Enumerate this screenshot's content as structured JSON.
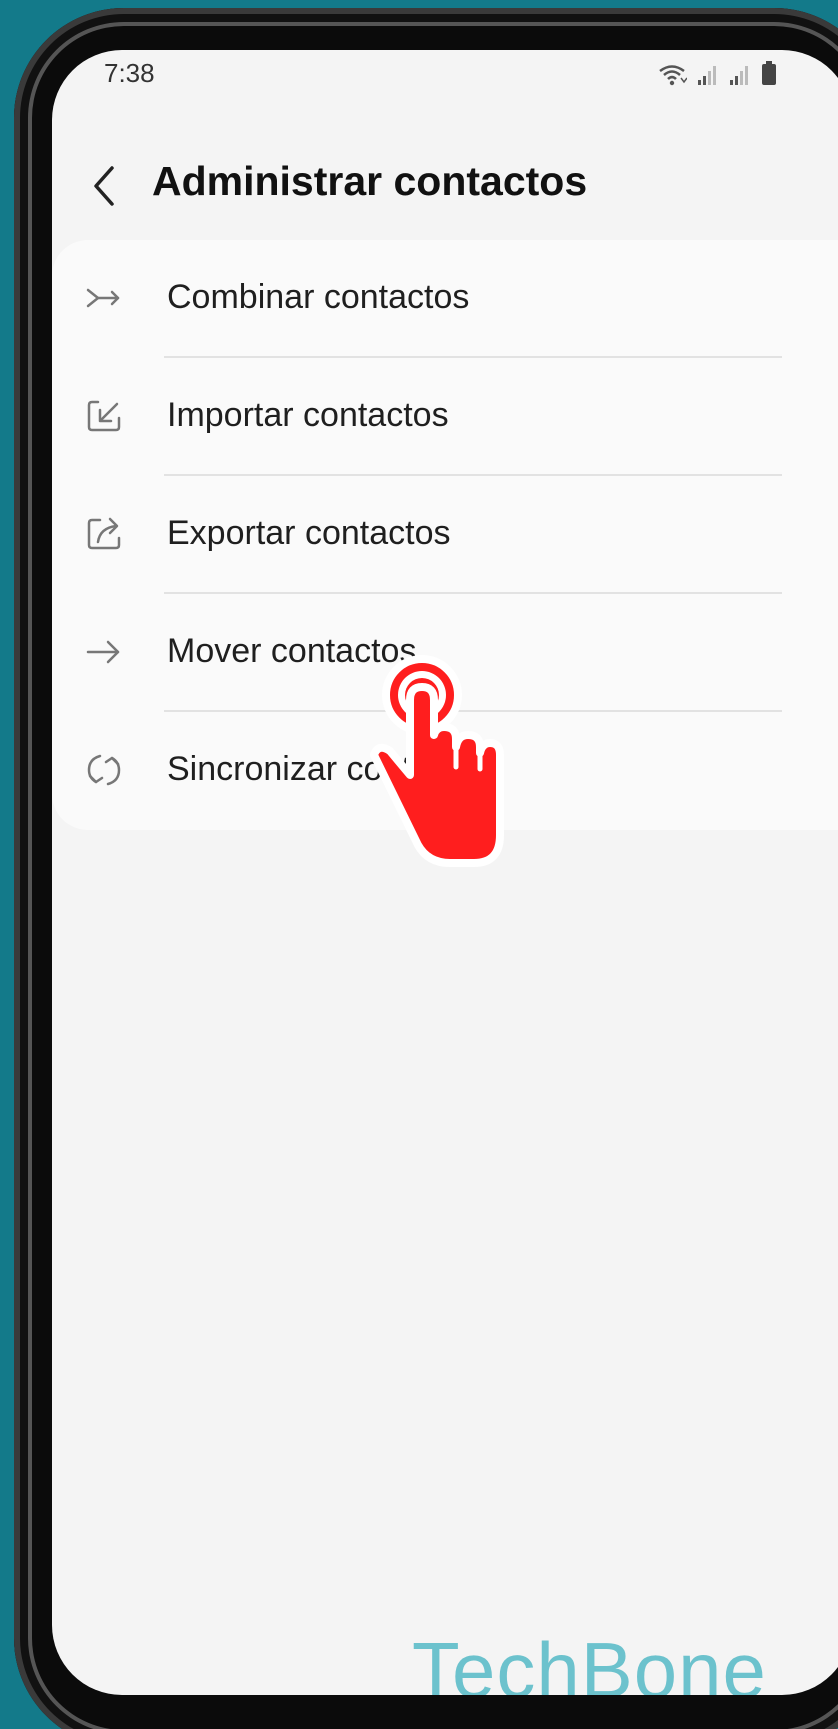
{
  "status_bar": {
    "time": "7:38",
    "icons": [
      "wifi-icon",
      "signal-icon",
      "signal-icon",
      "battery-icon"
    ]
  },
  "header": {
    "back_icon": "chevron-left-icon",
    "title": "Administrar contactos"
  },
  "menu": {
    "items": [
      {
        "label": "Combinar contactos",
        "icon": "merge-icon"
      },
      {
        "label": "Importar contactos",
        "icon": "import-icon"
      },
      {
        "label": "Exportar contactos",
        "icon": "export-icon"
      },
      {
        "label": "Mover contactos",
        "icon": "arrow-right-icon"
      },
      {
        "label": "Sincronizar contactos",
        "icon": "sync-icon"
      }
    ]
  },
  "overlay": {
    "tap_indicator_icon": "tap-hand-icon",
    "watermark": "TechBone"
  },
  "colors": {
    "background": "#137a8a",
    "screen": "#f4f4f4",
    "card": "#fafafa",
    "tap_indicator": "#ff1e1e",
    "watermark": "#6cc2cd"
  }
}
